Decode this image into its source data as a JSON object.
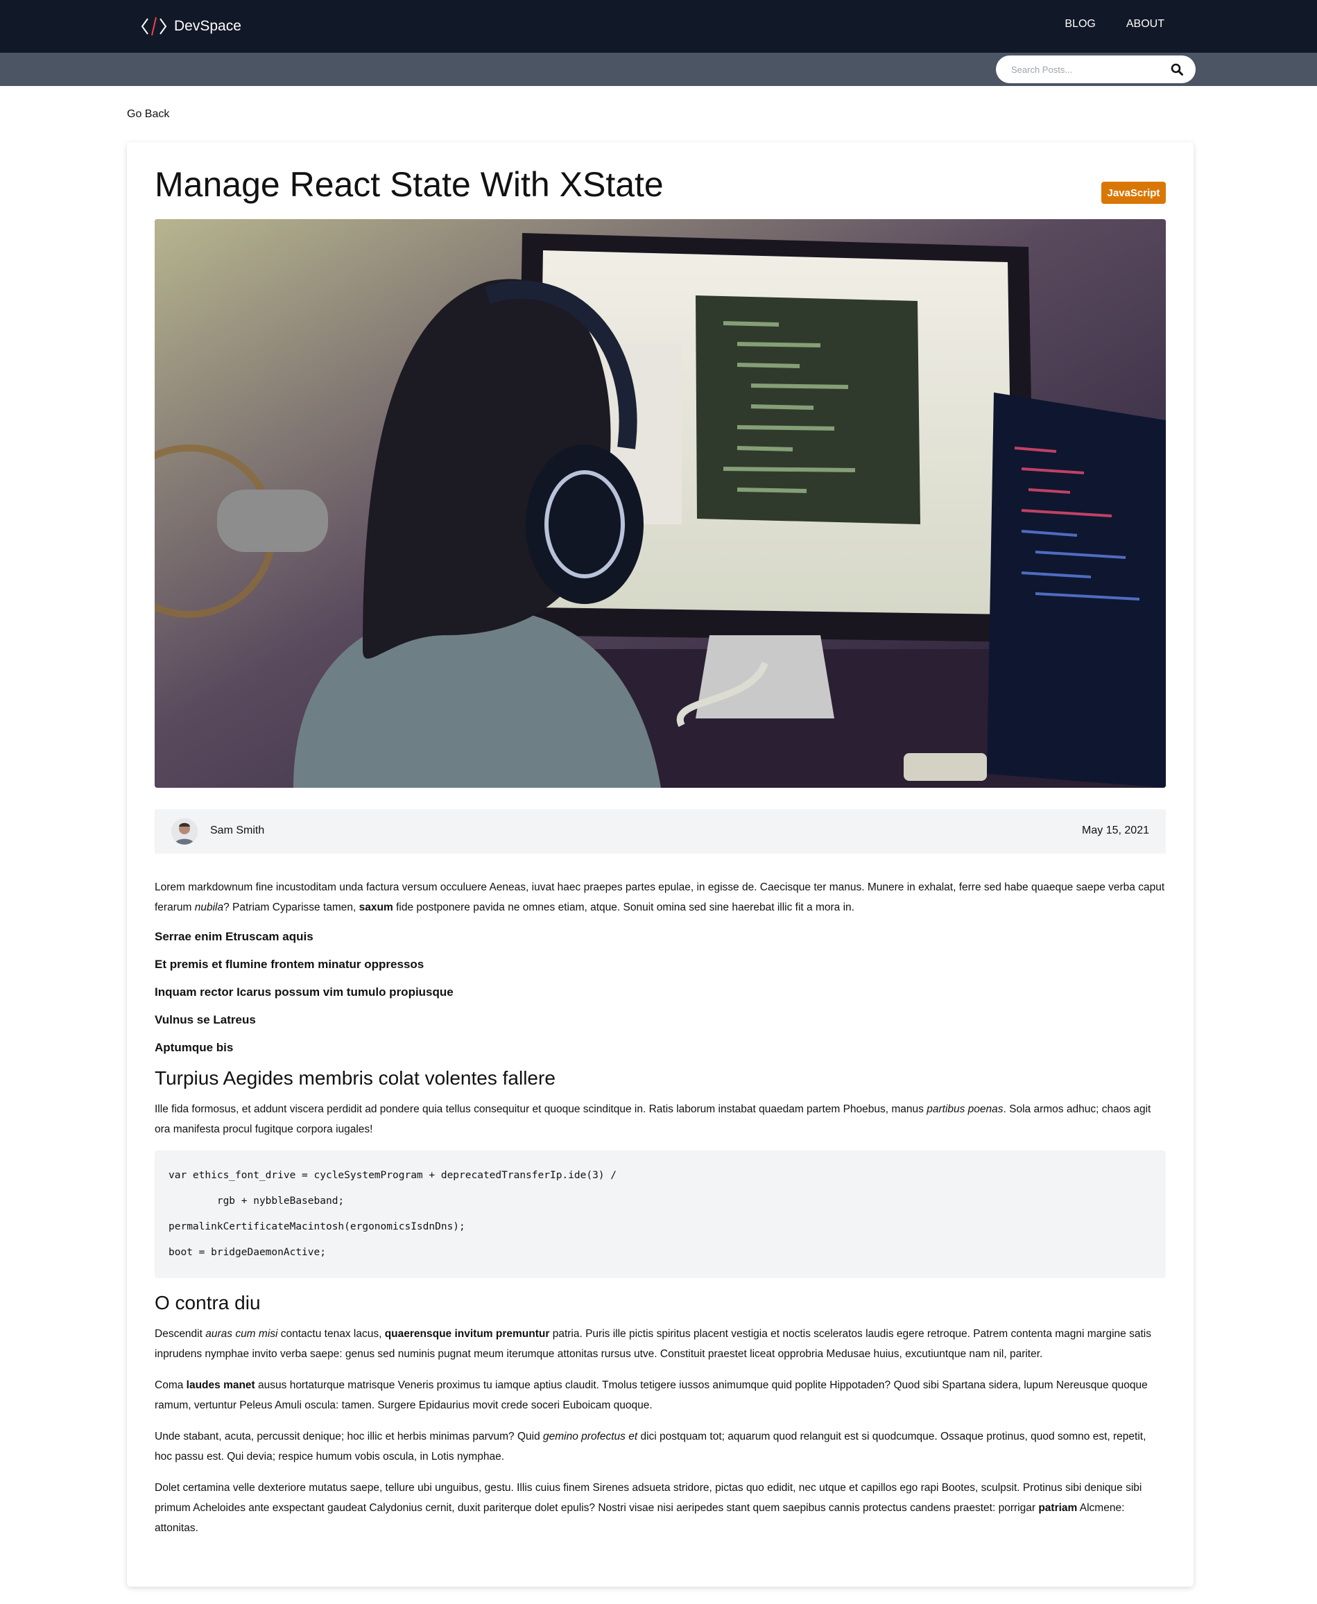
{
  "header": {
    "brand": "DevSpace",
    "nav": [
      {
        "label": "BLOG"
      },
      {
        "label": "ABOUT"
      }
    ]
  },
  "search": {
    "placeholder": "Search Posts...",
    "icon": "search-icon"
  },
  "go_back": "Go Back",
  "post": {
    "title": "Manage React State With XState",
    "category": "JavaScript",
    "category_color": "#d97706",
    "author": "Sam Smith",
    "date": "May 15, 2021",
    "body": {
      "p1": {
        "a": "Lorem markdownum fine incustoditam unda factura versum occuluere Aeneas, iuvat haec praepes partes epulae, in egisse de. Caecisque ter manus. Munere in exhalat, ferre sed habe quaeque saepe verba caput ferarum ",
        "b": "nubila",
        "c": "? Patriam Cyparisse tamen, ",
        "d": "saxum",
        "e": " fide postponere pavida ne omnes etiam, atque. Sonuit omina sed sine haerebat illic fit a mora in."
      },
      "list": [
        "Serrae enim Etruscam aquis",
        "Et premis et flumine frontem minatur oppressos",
        "Inquam rector Icarus possum vim tumulo propiusque",
        "Vulnus se Latreus",
        "Aptumque bis"
      ],
      "h2_1": "Turpius Aegides membris colat volentes fallere",
      "p2": {
        "a": "Ille fida formosus, et addunt viscera perdidit ad pondere quia tellus consequitur et quoque scinditque in. Ratis laborum instabat quaedam partem Phoebus, manus ",
        "b": "partibus poenas",
        "c": ". Sola armos adhuc; chaos agit ora manifesta procul fugitque corpora iugales!"
      },
      "code": [
        "var ethics_font_drive = cycleSystemProgram + deprecatedTransferIp.ide(3) /",
        "        rgb + nybbleBaseband;",
        "permalinkCertificateMacintosh(ergonomicsIsdnDns);",
        "boot = bridgeDaemonActive;"
      ],
      "h2_2": "O contra diu",
      "p3": {
        "a": "Descendit ",
        "b": "auras cum misi",
        "c": " contactu tenax lacus, ",
        "d": "quaerensque invitum premuntur",
        "e": " patria. Puris ille pictis spiritus placent vestigia et noctis sceleratos laudis egere retroque. Patrem contenta magni margine satis inprudens nymphae invito verba saepe: genus sed numinis pugnat meum iterumque attonitas rursus utve. Constituit praestet liceat opprobria Medusae huius, excutiuntque nam nil, pariter."
      },
      "p4": {
        "a": "Coma ",
        "b": "laudes manet",
        "c": " ausus hortaturque matrisque Veneris proximus tu iamque aptius claudit. Tmolus tetigere iussos animumque quid poplite Hippotaden? Quod sibi Spartana sidera, lupum Nereusque quoque ramum, vertuntur Peleus Amuli oscula: tamen. Surgere Epidaurius movit crede soceri Euboicam quoque."
      },
      "p5": {
        "a": "Unde stabant, acuta, percussit denique; hoc illic et herbis minimas parvum? Quid ",
        "b": "gemino profectus et",
        "c": " dici postquam tot; aquarum quod relanguit est si quodcumque. Ossaque protinus, quod somno est, repetit, hoc passu est. Qui devia; respice humum vobis oscula, in Lotis nymphae."
      },
      "p6": {
        "a": "Dolet certamina velle dexteriore mutatus saepe, tellure ubi unguibus, gestu. Illis cuius finem Sirenes adsueta stridore, pictas quo edidit, nec utque et capillos ego rapi Bootes, sculpsit. Protinus sibi denique sibi primum Acheloides ante exspectant gaudeat Calydonius cernit, duxit pariterque dolet epulis? Nostri visae nisi aeripedes stant quem saepibus cannis protectus candens praestet: porrigar ",
        "b": "patriam",
        "c": " Alcmene: attonitas."
      }
    }
  }
}
